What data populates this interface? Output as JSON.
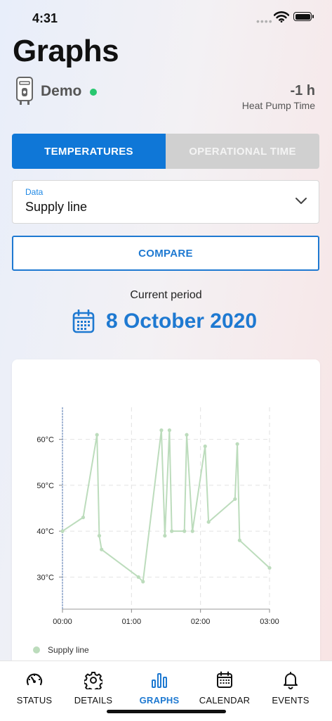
{
  "status_bar": {
    "time": "4:31",
    "signal_dots": "••••"
  },
  "header": {
    "title": "Graphs"
  },
  "device": {
    "name": "Demo",
    "status_color": "#28c76f",
    "icon": "water-heater-icon"
  },
  "heat_pump_time": {
    "value": "-1 h",
    "label": "Heat Pump Time"
  },
  "tabs_segment": {
    "active": {
      "label": "TEMPERATURES"
    },
    "inactive": {
      "label": "OPERATIONAL TIME"
    }
  },
  "data_select": {
    "label": "Data",
    "value": "Supply line"
  },
  "compare_button": {
    "label": "COMPARE"
  },
  "period": {
    "label": "Current period",
    "date": "8 October 2020"
  },
  "colors": {
    "accent": "#1e79d1",
    "active_tab": "#0f77d7",
    "inactive_tab": "#d0d0d0",
    "series": "#bcdcbc"
  },
  "chart_data": {
    "type": "line",
    "y_ticks": [
      "60°C",
      "50°C",
      "40°C",
      "30°C"
    ],
    "x_ticks": [
      "00:00",
      "01:00",
      "02:00",
      "03:00"
    ],
    "ylim": [
      23,
      67
    ],
    "xlim": [
      0,
      180
    ],
    "grid": true,
    "legend_placement": "bottom-left",
    "series": [
      {
        "name": "Supply line",
        "color": "#bcdcbc",
        "points": [
          [
            0,
            40
          ],
          [
            18,
            43
          ],
          [
            30,
            61
          ],
          [
            32,
            39
          ],
          [
            34,
            36
          ],
          [
            66,
            30
          ],
          [
            70,
            29
          ],
          [
            86,
            62
          ],
          [
            89,
            39
          ],
          [
            93,
            62
          ],
          [
            95,
            40
          ],
          [
            106,
            40
          ],
          [
            108,
            61
          ],
          [
            113,
            40
          ],
          [
            124,
            58.5
          ],
          [
            127,
            42
          ],
          [
            150,
            47
          ],
          [
            152,
            59
          ],
          [
            154,
            38
          ],
          [
            180,
            32
          ]
        ]
      }
    ]
  },
  "bottom_nav": {
    "items": [
      {
        "label": "STATUS"
      },
      {
        "label": "DETAILS"
      },
      {
        "label": "GRAPHS"
      },
      {
        "label": "CALENDAR"
      },
      {
        "label": "EVENTS"
      }
    ]
  }
}
